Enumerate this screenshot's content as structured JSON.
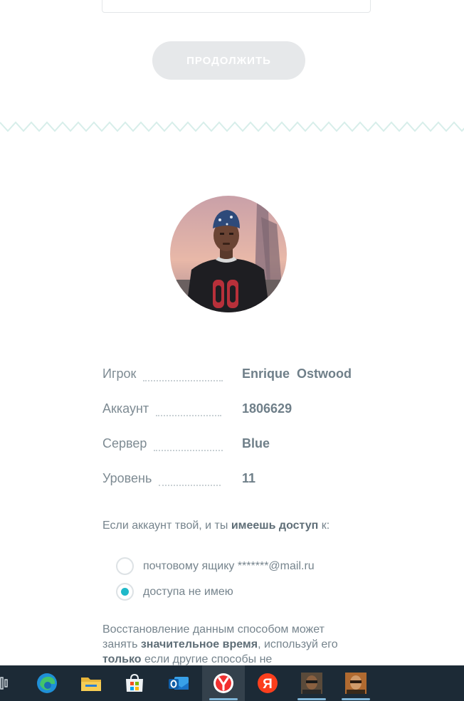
{
  "continue_button": {
    "label": "ПРОДОЛЖИТЬ"
  },
  "profile": {
    "rows": [
      {
        "label": "Игрок",
        "value": "Enrique  Ostwood"
      },
      {
        "label": "Аккаунт",
        "value": "1806629"
      },
      {
        "label": "Сервер",
        "value": "Blue"
      },
      {
        "label": "Уровень",
        "value": "11"
      }
    ]
  },
  "access": {
    "prefix": "Если аккаунт твой, и ты ",
    "bold": "имеешь доступ",
    "suffix": " к:"
  },
  "options": [
    {
      "label": "почтовому ящику *******@mail.ru",
      "selected": false
    },
    {
      "label": "доступа не имею",
      "selected": true
    }
  ],
  "note": {
    "part1": "Восстановление данным способом может занять ",
    "bold1": "значительное время",
    "part2": ", используй его ",
    "bold2": "только",
    "part3": " если другие способы не"
  },
  "colors": {
    "accent": "#1fb9c9",
    "zigzag": "#d7eeea",
    "taskbar": "#1c2a36"
  },
  "taskbar": {
    "icons": [
      "task-view-icon",
      "edge-icon",
      "file-explorer-icon",
      "microsoft-store-icon",
      "outlook-icon",
      "yandex-browser-icon",
      "yandex-icon",
      "game-avatar-icon-1",
      "game-avatar-icon-2"
    ]
  }
}
